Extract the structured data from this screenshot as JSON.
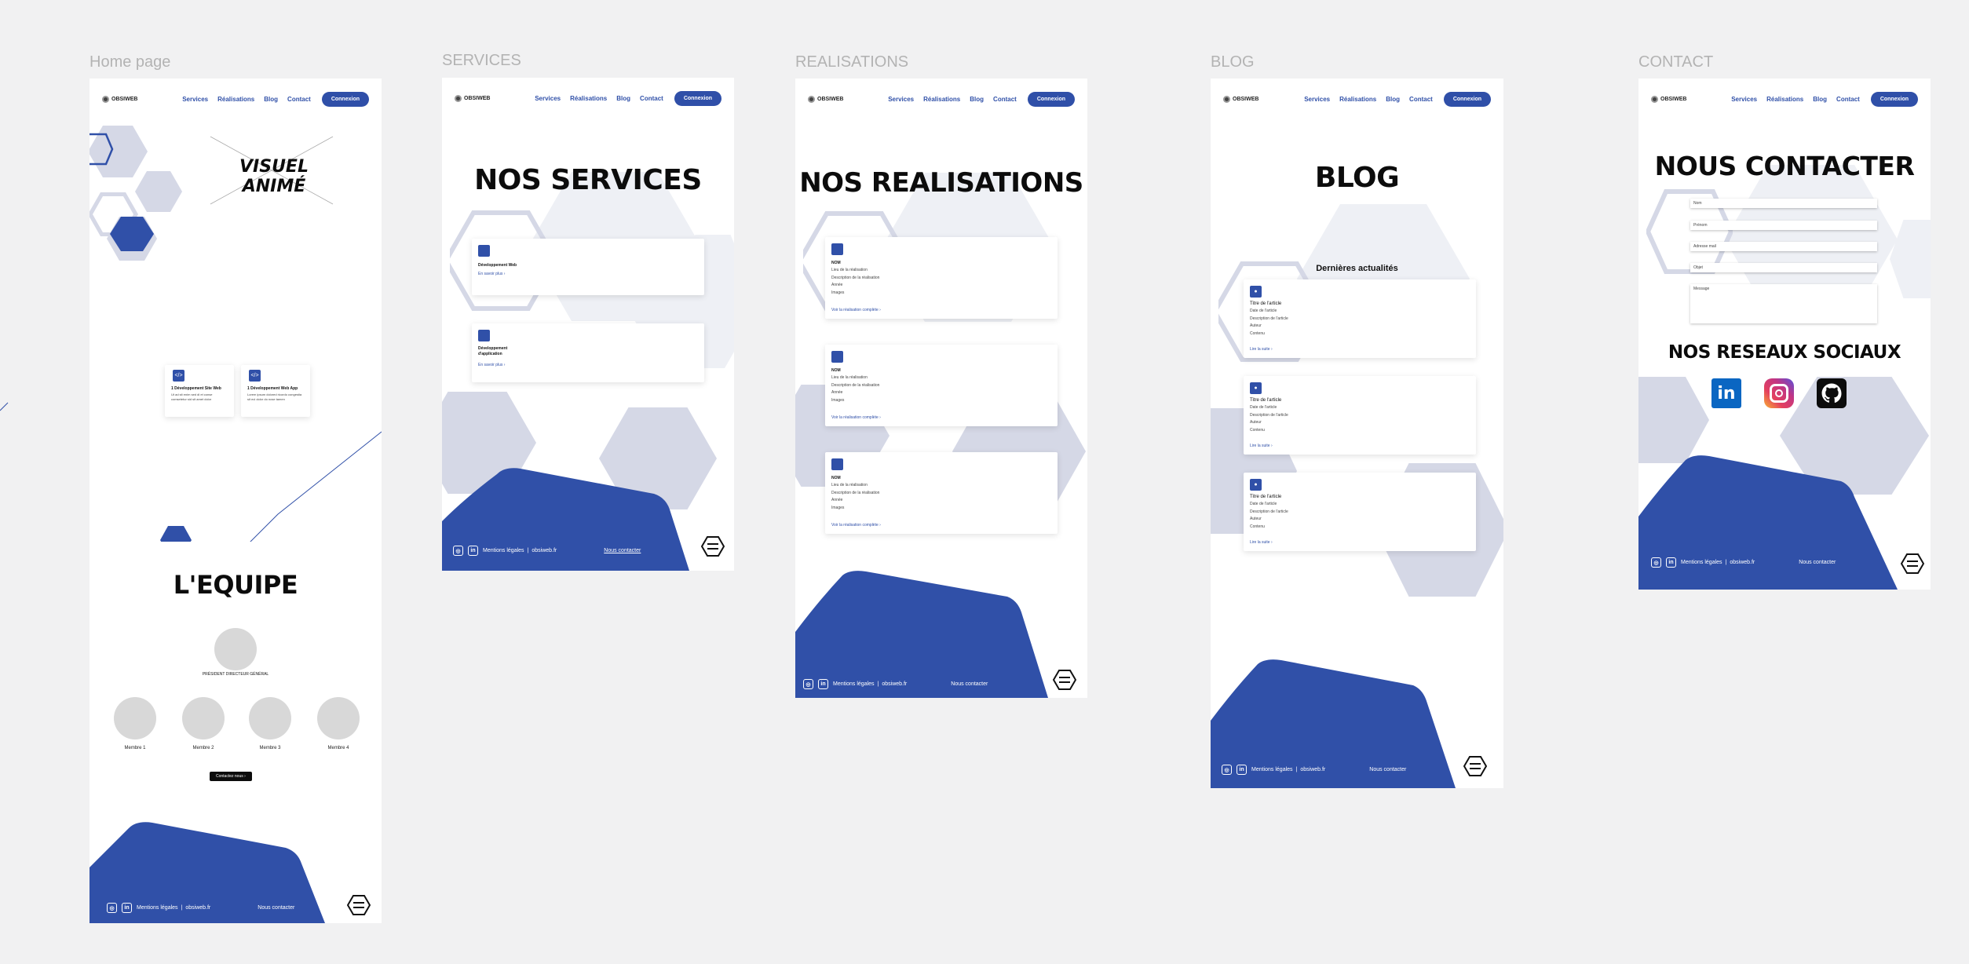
{
  "frames": {
    "home": "Home page",
    "services": "SERVICES",
    "realisations": "REALISATIONS",
    "blog": "BLOG",
    "contact": "CONTACT"
  },
  "nav": {
    "logo": "OBSIWEB",
    "services": "Services",
    "realisations": "Réalisations",
    "blog": "Blog",
    "contact": "Contact",
    "login": "Connexion"
  },
  "home": {
    "hero": "VISUEL ANIMÉ",
    "card1": {
      "title": "1 Développement Site Web",
      "text": "Ut ad sit enim sed di et conse comsetetur sid sit amet dolor"
    },
    "card2": {
      "title": "1 Développement Web App",
      "text": "Lorem ipsum dolored ricordo congestia sit eci dolor do nose tamen"
    },
    "team_title": "L'EQUIPE",
    "president": "PRÉSIDENT DIRECTEUR GÉNÉRAL",
    "members": [
      "Membre 1",
      "Membre 2",
      "Membre 3",
      "Membre 4"
    ],
    "cta": "Contactez nous"
  },
  "footer": {
    "legal": "Mentions légales",
    "sep": "|",
    "site": "obsiweb.fr",
    "contact": "Nous contacter"
  },
  "services": {
    "title": "NOS SERVICES",
    "card1": "Développement Web",
    "card2": "Développement d'application",
    "more": "En savoir plus"
  },
  "realisations": {
    "title": "NOS REALISATIONS",
    "name": "NOM",
    "lines": [
      "Lieu de la réalisation",
      "Description de la réalisation",
      "Année",
      "Images"
    ],
    "link": "Voir la réalisation complète"
  },
  "blog": {
    "title": "BLOG",
    "subtitle": "Dernières actualités",
    "card_title": "Titre de l'article",
    "lines": [
      "Date de l'article",
      "Description de l'article",
      "Auteur",
      "Contenu"
    ],
    "link": "Lire la suite"
  },
  "contact": {
    "title": "NOUS CONTACTER",
    "fields": [
      "Nom",
      "Prénom",
      "Adresse mail",
      "Objet",
      "Message"
    ],
    "social_title": "NOS RESEAUX SOCIAUX",
    "socials": [
      "linkedin-icon",
      "instagram-icon",
      "github-icon"
    ]
  },
  "colors": {
    "primary": "#3050a8",
    "light": "#d5d8e6",
    "bg": "#f1f1f2"
  }
}
